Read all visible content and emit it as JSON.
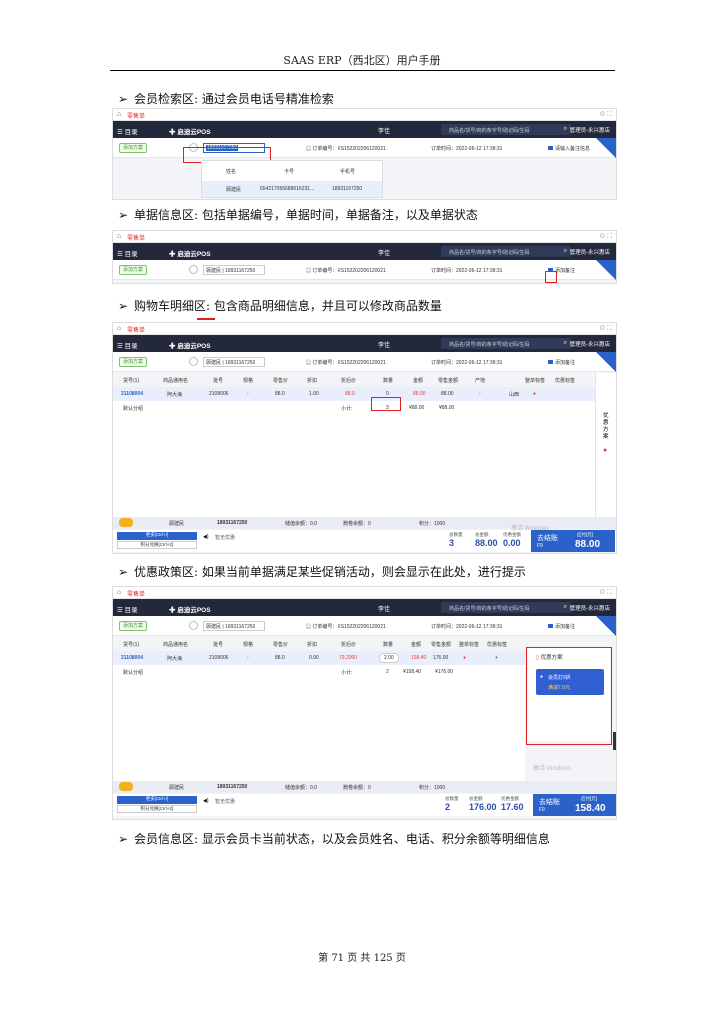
{
  "header": {
    "title": "SAAS ERP（西北区）用户手册"
  },
  "bullets": [
    "会员检索区: 通过会员电话号精准检索",
    "单据信息区: 包括单据编号，单据时间，单据备注，以及单据状态",
    "购物车明细区: 包含商品明细信息，并且可以修改商品数量",
    "优惠政策区: 如果当前单据满足某些促销活动，则会显示在此处，进行提示",
    "会员信息区: 显示会员卡当前状态，以及会员姓名、电话、积分余额等明细信息"
  ],
  "pos": {
    "tab_label": "零售单",
    "menu_label": "目录",
    "logo": "启迪云POS",
    "cashier": "李佳",
    "search_placeholder": "商品名/货号/商的条字号/助记码/生码",
    "store": "管理员-永兴惠店",
    "member_btn": "添加方案",
    "member_phone": "18931167250",
    "member_full": "顾建民 | 18931167250",
    "order_no": "订单编号：XS152202206120021",
    "order_time": "订单时间：2022-06-12 17:38:31",
    "note_placeholder": "请输入备注信息",
    "note_label": "添加备注",
    "corner": "零售",
    "dropdown": {
      "headers": [
        "姓名",
        "卡号",
        "手机号"
      ],
      "row": [
        "顾建民",
        "654217056688616231...",
        "18931167250"
      ]
    },
    "grid_headers": [
      "货号(1)",
      "商品通用名",
      "批号",
      "规格",
      "零售价",
      "折扣",
      "折后价",
      "数量",
      "金额",
      "零售金额",
      "产地",
      "整单标签",
      "优惠标签"
    ],
    "row1": {
      "code": "21108004",
      "name": "阿大海",
      "batch": "2108006",
      "spec": "-",
      "price": "88.0",
      "discount": "1.00",
      "after": "88.0",
      "qty": "0",
      "amount": "88.00",
      "retail": "88.00",
      "origin": "-",
      "tag": "山西"
    },
    "row2": {
      "code": "21108004",
      "name": "阿大海",
      "batch": "2108006",
      "spec": "-",
      "price": "88.0",
      "discount": "0.90",
      "after": "79.2000",
      "qty": "2.00",
      "amount": "158.40",
      "retail": "176.00",
      "plus": "+"
    },
    "sum_label": "默认分组",
    "sum_sub": "小计:",
    "sum3": {
      "qty": "3",
      "amount": "¥88.00",
      "retail": "¥88.00"
    },
    "sum4": {
      "qty": "2",
      "amount": "¥158.40",
      "retail": "¥176.00"
    },
    "side_promo": "优惠方案",
    "promo_title": "优惠方案",
    "promo_card": "会员打9折",
    "promo_sub": "满减7.6元",
    "member_info": {
      "name": "顾建民",
      "phone": "18931167250",
      "stored": "储值余额：0.0",
      "gift": "赠卷余额：0",
      "points": "积分：1000"
    },
    "labels": {
      "more": "更多[Ctrl+/]",
      "points_pay": "积分兑换[Ctrl+Z]",
      "hint": "暂无优惠",
      "count": "总数量",
      "total": "总金额",
      "discount": "优惠金额",
      "checkout": "去结账",
      "hotkey": "F9",
      "collect": "应付[元]"
    },
    "totals3": {
      "count": "3",
      "total": "88.00",
      "discount": "0.00",
      "pay": "88.00"
    },
    "totals4": {
      "count": "2",
      "total": "176.00",
      "discount": "17.60",
      "pay": "158.40"
    },
    "watermark": "激活 Windows"
  },
  "footer": {
    "text": "第 71 页 共 125 页"
  }
}
